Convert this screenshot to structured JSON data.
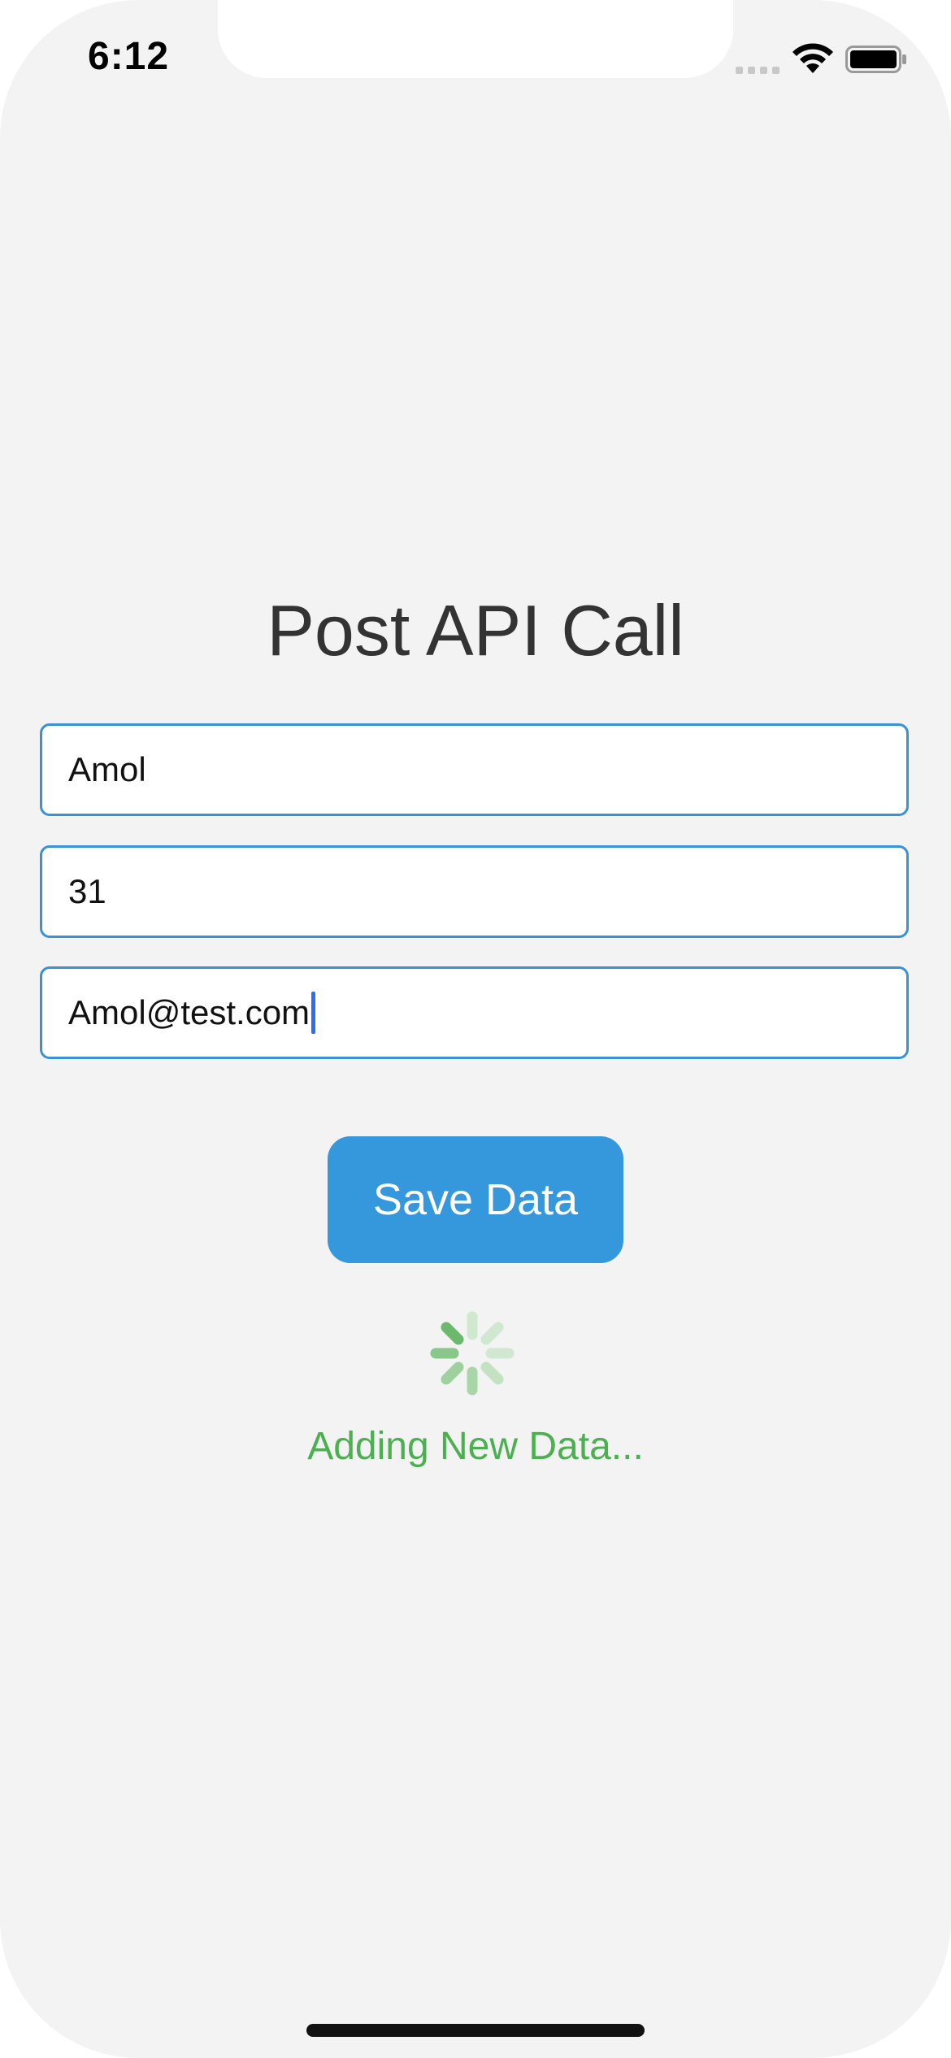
{
  "status_bar": {
    "time": "6:12",
    "icons": [
      "signal-icon",
      "wifi-icon",
      "battery-icon"
    ]
  },
  "title": "Post API Call",
  "form": {
    "name_value": "Amol",
    "age_value": "31",
    "email_value": "Amol@test.com"
  },
  "save_button_label": "Save Data",
  "status_message": "Adding New Data...",
  "colors": {
    "accent": "#3698dc",
    "status_green": "#4caf50",
    "background": "#f3f3f3"
  }
}
